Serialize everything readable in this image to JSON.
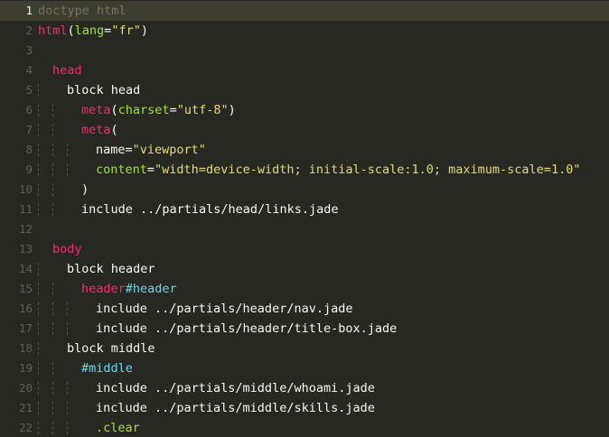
{
  "editor": {
    "current_line": 1,
    "theme_colors": {
      "background": "#272822",
      "current_line": "#3e3d32",
      "gutter": "#5f5e52",
      "text": "#f8f8f2",
      "comment": "#75715e",
      "tag": "#f92672",
      "attribute": "#a6e22e",
      "string": "#e6db74",
      "id": "#66d9ef",
      "class": "#a6e22e"
    },
    "lines": [
      {
        "number": "1",
        "indent": 0,
        "tokens": [
          {
            "type": "comment",
            "text": "doctype html"
          }
        ]
      },
      {
        "number": "2",
        "indent": 0,
        "tokens": [
          {
            "type": "tag",
            "text": "html"
          },
          {
            "type": "plain",
            "text": "("
          },
          {
            "type": "attr",
            "text": "lang"
          },
          {
            "type": "plain",
            "text": "="
          },
          {
            "type": "str",
            "text": "\"fr\""
          },
          {
            "type": "plain",
            "text": ")"
          }
        ]
      },
      {
        "number": "3",
        "indent": 0,
        "tokens": []
      },
      {
        "number": "4",
        "indent": 1,
        "tokens": [
          {
            "type": "tag",
            "text": "head"
          }
        ]
      },
      {
        "number": "5",
        "indent": 2,
        "tokens": [
          {
            "type": "plain",
            "text": "block head"
          }
        ]
      },
      {
        "number": "6",
        "indent": 3,
        "tokens": [
          {
            "type": "tag",
            "text": "meta"
          },
          {
            "type": "plain",
            "text": "("
          },
          {
            "type": "attr",
            "text": "charset"
          },
          {
            "type": "plain",
            "text": "="
          },
          {
            "type": "str",
            "text": "\"utf-8\""
          },
          {
            "type": "plain",
            "text": ")"
          }
        ]
      },
      {
        "number": "7",
        "indent": 3,
        "tokens": [
          {
            "type": "tag",
            "text": "meta"
          },
          {
            "type": "plain",
            "text": "("
          }
        ]
      },
      {
        "number": "8",
        "indent": 4,
        "tokens": [
          {
            "type": "plain",
            "text": "name"
          },
          {
            "type": "plain",
            "text": "="
          },
          {
            "type": "str",
            "text": "\"viewport\""
          }
        ]
      },
      {
        "number": "9",
        "indent": 4,
        "tokens": [
          {
            "type": "attr",
            "text": "content"
          },
          {
            "type": "plain",
            "text": "="
          },
          {
            "type": "str",
            "text": "\"width=device-width; initial-scale:1.0; maximum-scale=1.0\""
          }
        ]
      },
      {
        "number": "10",
        "indent": 3,
        "tokens": [
          {
            "type": "plain",
            "text": ")"
          }
        ]
      },
      {
        "number": "11",
        "indent": 3,
        "tokens": [
          {
            "type": "plain",
            "text": "include ../partials/head/links.jade"
          }
        ]
      },
      {
        "number": "12",
        "indent": 0,
        "tokens": []
      },
      {
        "number": "13",
        "indent": 1,
        "tokens": [
          {
            "type": "tag",
            "text": "body"
          }
        ]
      },
      {
        "number": "14",
        "indent": 2,
        "tokens": [
          {
            "type": "plain",
            "text": "block header"
          }
        ]
      },
      {
        "number": "15",
        "indent": 3,
        "tokens": [
          {
            "type": "tag",
            "text": "header"
          },
          {
            "type": "id",
            "text": "#header"
          }
        ]
      },
      {
        "number": "16",
        "indent": 4,
        "tokens": [
          {
            "type": "plain",
            "text": "include ../partials/header/nav.jade"
          }
        ]
      },
      {
        "number": "17",
        "indent": 4,
        "tokens": [
          {
            "type": "plain",
            "text": "include ../partials/header/title-box.jade"
          }
        ]
      },
      {
        "number": "18",
        "indent": 2,
        "tokens": [
          {
            "type": "plain",
            "text": "block middle"
          }
        ]
      },
      {
        "number": "19",
        "indent": 3,
        "tokens": [
          {
            "type": "id",
            "text": "#middle"
          }
        ]
      },
      {
        "number": "20",
        "indent": 4,
        "tokens": [
          {
            "type": "plain",
            "text": "include ../partials/middle/whoami.jade"
          }
        ]
      },
      {
        "number": "21",
        "indent": 4,
        "tokens": [
          {
            "type": "plain",
            "text": "include ../partials/middle/skills.jade"
          }
        ]
      },
      {
        "number": "22",
        "indent": 4,
        "tokens": [
          {
            "type": "cls",
            "text": ".clear"
          }
        ]
      }
    ]
  }
}
